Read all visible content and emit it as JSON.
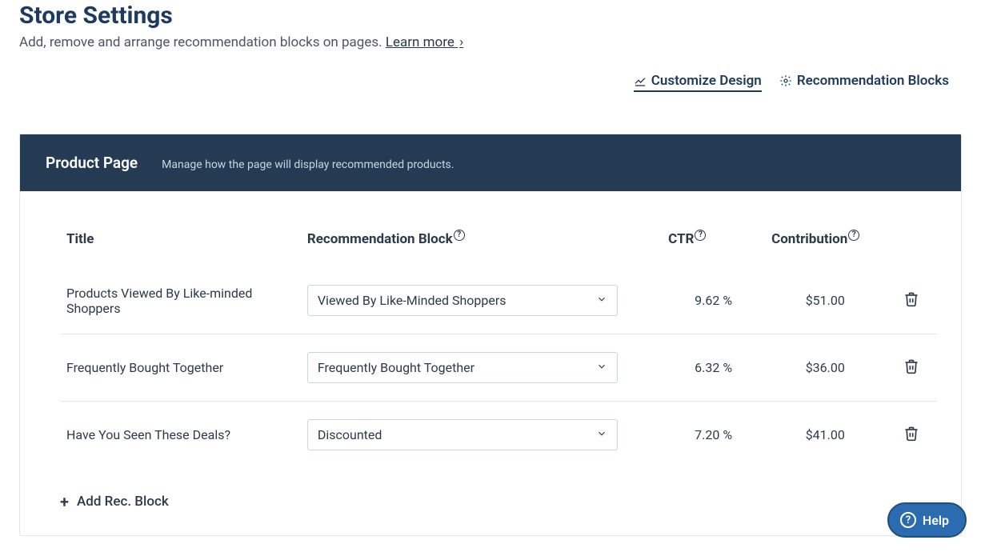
{
  "header": {
    "title": "Store Settings",
    "subtitle_prefix": "Add, remove and arrange recommendation blocks on pages. ",
    "learn_more": "Learn more"
  },
  "top_actions": {
    "customize": "Customize Design",
    "rec_blocks": "Recommendation Blocks"
  },
  "panel": {
    "title": "Product Page",
    "subtitle": "Manage how the page will display recommended products."
  },
  "columns": {
    "title": "Title",
    "block": "Recommendation Block",
    "ctr": "CTR",
    "contribution": "Contribution"
  },
  "rows": [
    {
      "title": "Products Viewed By Like-minded Shoppers",
      "block": "Viewed By Like-Minded Shoppers",
      "ctr": "9.62 %",
      "contribution": "$51.00"
    },
    {
      "title": "Frequently Bought Together",
      "block": "Frequently Bought Together",
      "ctr": "6.32 %",
      "contribution": "$36.00"
    },
    {
      "title": "Have You Seen These Deals?",
      "block": "Discounted",
      "ctr": "7.20 %",
      "contribution": "$41.00"
    }
  ],
  "add_block_label": "Add Rec. Block",
  "help_label": "Help"
}
